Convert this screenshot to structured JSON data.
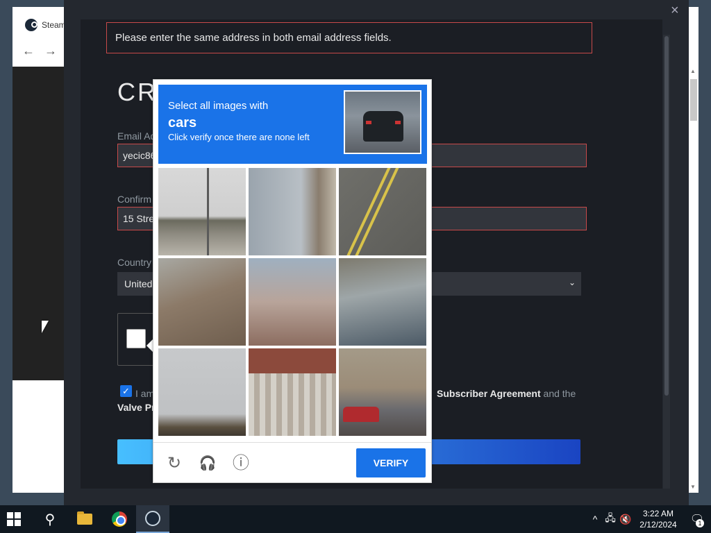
{
  "browser": {
    "tab_title": "Steam",
    "back_glyph": "←",
    "forward_glyph": "→"
  },
  "modal": {
    "close_glyph": "×",
    "error_message": "Please enter the same address in both email address fields.",
    "page_title_partial": "CR",
    "email_label_partial": "Email Ad",
    "email_value_partial": "yecic86",
    "confirm_label_partial": "Confirm",
    "confirm_value_partial": "15 Stre",
    "country_label_partial": "Country",
    "country_value_partial": "United",
    "agree_lead_partial": "I am",
    "agree_subscriber_text": "Subscriber Agreement",
    "agree_and_the": " and the",
    "agree_line2_partial": "Valve Pr",
    "chevron_glyph": "⌄",
    "error_color": "#c94a4a",
    "accent_color": "#1a73e8"
  },
  "recaptcha": {
    "instruction_line1": "Select all images with",
    "instruction_target": "cars",
    "instruction_line2": "Click verify once there are none left",
    "verify_label": "VERIFY",
    "reload_glyph": "↻",
    "audio_glyph": "🎧",
    "info_glyph": "ⓘ",
    "tiles": [
      "tile-1",
      "tile-2",
      "tile-3",
      "tile-4",
      "tile-5",
      "tile-6",
      "tile-7",
      "tile-8",
      "tile-9"
    ]
  },
  "taskbar": {
    "search_glyph": "⚲",
    "tray_up_glyph": "^",
    "time": "3:22 AM",
    "date": "2/12/2024",
    "notification_count": "1",
    "network_glyph": "🖧",
    "volume_glyph": "🔇",
    "notification_glyph": "🗨"
  }
}
